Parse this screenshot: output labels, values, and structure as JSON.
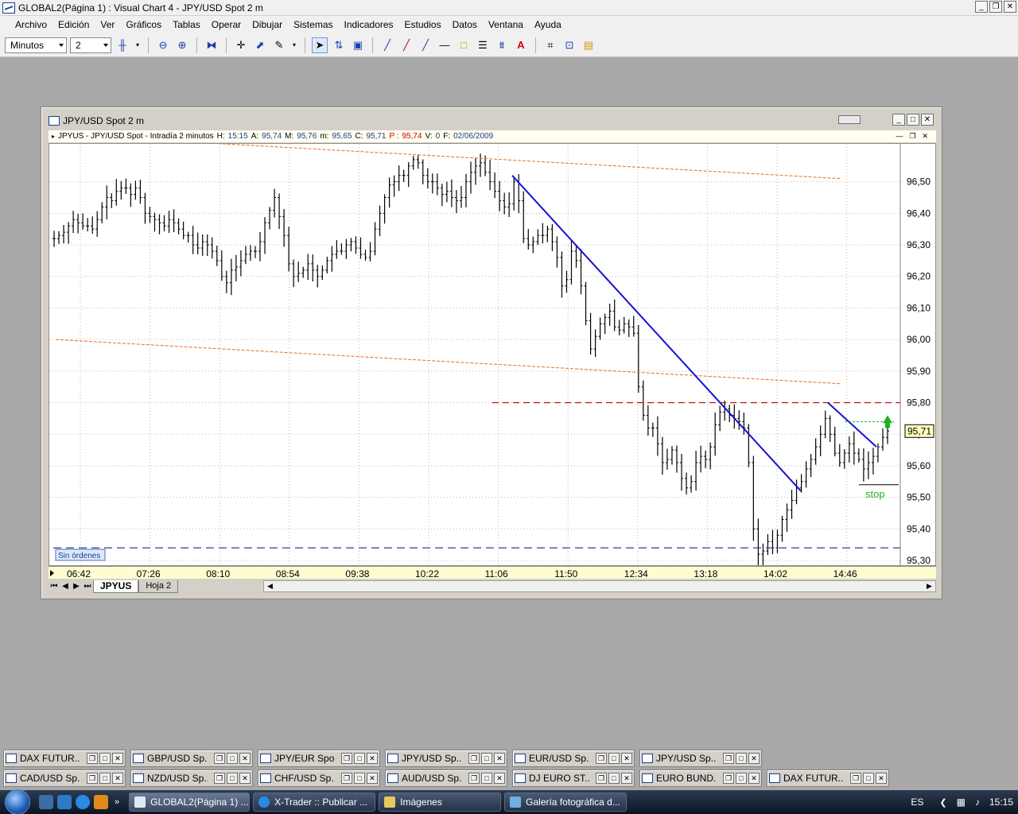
{
  "app": {
    "title": "GLOBAL2(Página 1) : Visual Chart 4 - JPY/USD Spot 2 m"
  },
  "menu": [
    "Archivo",
    "Edición",
    "Ver",
    "Gráficos",
    "Tablas",
    "Operar",
    "Dibujar",
    "Sistemas",
    "Indicadores",
    "Estudios",
    "Datos",
    "Ventana",
    "Ayuda"
  ],
  "toolbar": {
    "period_unit": "Minutos",
    "period_value": "2"
  },
  "chart_window": {
    "title": "JPY/USD Spot 2 m",
    "info": {
      "symbol": "JPYUS - JPY/USD Spot - Intradía 2 minutos",
      "h_label": "H:",
      "h_value": "15:15",
      "a_label": "A:",
      "a_value": "95,74",
      "m_label": "M:",
      "m_value": "95,76",
      "min_label": "m:",
      "min_value": "95,65",
      "c_label": "C:",
      "c_value": "95,71",
      "p_label": "P :",
      "p_value": "95,74",
      "v_label": "V:",
      "v_value": "0",
      "f_label": "F:",
      "f_value": "02/06/2009"
    },
    "orders_label": "Sin órdenes",
    "stop_label": "stop",
    "current_price": "95,71",
    "sheet_tabs": [
      "JPYUS",
      "Hoja 2"
    ]
  },
  "chart_data": {
    "type": "line",
    "title": "JPY/USD Spot 2 m",
    "y_ticks": [
      "96,50",
      "96,40",
      "96,30",
      "96,20",
      "96,10",
      "96,00",
      "95,90",
      "95,80",
      "95,70",
      "95,60",
      "95,50",
      "95,40",
      "95,30"
    ],
    "y_tick_values": [
      96.5,
      96.4,
      96.3,
      96.2,
      96.1,
      96.0,
      95.9,
      95.8,
      95.7,
      95.6,
      95.5,
      95.4,
      95.3
    ],
    "ylim": [
      95.28,
      96.62
    ],
    "x_ticks": [
      "06:42",
      "07:26",
      "08:10",
      "08:54",
      "09:38",
      "10:22",
      "11:06",
      "11:50",
      "12:34",
      "13:18",
      "14:02",
      "14:46"
    ],
    "series": [
      {
        "style": "bars",
        "values": [
          96.32,
          96.33,
          96.34,
          96.36,
          96.38,
          96.37,
          96.36,
          96.36,
          96.35,
          96.38,
          96.42,
          96.45,
          96.44,
          96.47,
          96.48,
          96.48,
          96.46,
          96.48,
          96.45,
          96.4,
          96.39,
          96.38,
          96.37,
          96.36,
          96.38,
          96.37,
          96.35,
          96.33,
          96.33,
          96.3,
          96.29,
          96.31,
          96.3,
          96.28,
          96.25,
          96.2,
          96.18,
          96.22,
          96.23,
          96.25,
          96.27,
          96.28,
          96.28,
          96.31,
          96.37,
          96.41,
          96.45,
          96.39,
          96.33,
          96.24,
          96.2,
          96.21,
          96.22,
          96.24,
          96.22,
          96.2,
          96.22,
          96.25,
          96.27,
          96.28,
          96.28,
          96.3,
          96.31,
          96.29,
          96.27,
          96.26,
          96.28,
          96.35,
          96.4,
          96.45,
          96.49,
          96.5,
          96.52,
          96.52,
          96.55,
          96.57,
          96.56,
          96.52,
          96.5,
          96.5,
          96.48,
          96.46,
          96.47,
          96.45,
          96.44,
          96.45,
          96.5,
          96.53,
          96.55,
          96.56,
          96.53,
          96.5,
          96.47,
          96.44,
          96.42,
          96.43,
          96.5,
          96.44,
          96.32,
          96.3,
          96.31,
          96.33,
          96.33,
          96.35,
          96.31,
          96.26,
          96.17,
          96.19,
          96.28,
          96.25,
          96.17,
          96.06,
          95.97,
          96.01,
          96.05,
          96.07,
          96.09,
          96.04,
          96.03,
          96.05,
          96.04,
          96.02,
          95.85,
          95.76,
          95.72,
          95.72,
          95.67,
          95.61,
          95.62,
          95.65,
          95.61,
          95.56,
          95.53,
          95.55,
          95.61,
          95.63,
          95.62,
          95.66,
          95.73,
          95.77,
          95.78,
          95.76,
          95.75,
          95.74,
          95.72,
          95.61,
          95.4,
          95.32,
          95.33,
          95.36,
          95.34,
          95.38,
          95.43,
          95.46,
          95.49,
          95.53,
          95.55,
          95.59,
          95.62,
          95.66,
          95.7,
          95.75,
          95.7,
          95.64,
          95.61,
          95.64,
          95.67,
          95.64,
          95.62,
          95.59,
          95.61,
          95.63,
          95.66,
          95.69,
          95.71
        ]
      },
      {
        "name": "upper-orange",
        "style": "dashed",
        "values": [
          96.65,
          96.51
        ]
      },
      {
        "name": "lower-orange",
        "style": "dashed",
        "values": [
          96.0,
          95.86
        ]
      }
    ],
    "levels": [
      {
        "value": 95.8,
        "color": "#cc0000",
        "style": "dashed"
      },
      {
        "value": 95.34,
        "color": "#1a2a8a",
        "style": "dashed"
      }
    ],
    "colors": {
      "bars": "#000000",
      "trendline": "#1414d4",
      "channel": "#e07020",
      "resistance": "#cc0000",
      "support": "#1a2a8a",
      "signal": "#20b020"
    }
  },
  "minimized_windows": [
    [
      "DAX FUTUR...",
      "GBP/USD Sp...",
      "JPY/EUR Spo...",
      "JPY/USD Sp...",
      "EUR/USD Sp...",
      "JPY/USD Sp..."
    ],
    [
      "CAD/USD Sp...",
      "NZD/USD Sp...",
      "CHF/USD Sp...",
      "AUD/USD Sp...",
      "DJ EURO ST...",
      "EURO BUND...",
      "DAX FUTUR..."
    ]
  ],
  "taskbar": {
    "buttons": [
      "GLOBAL2(Página 1) ...",
      "X-Trader :: Publicar ...",
      "Imágenes",
      "Galería fotográfica d..."
    ],
    "language": "ES",
    "clock": "15:15"
  }
}
